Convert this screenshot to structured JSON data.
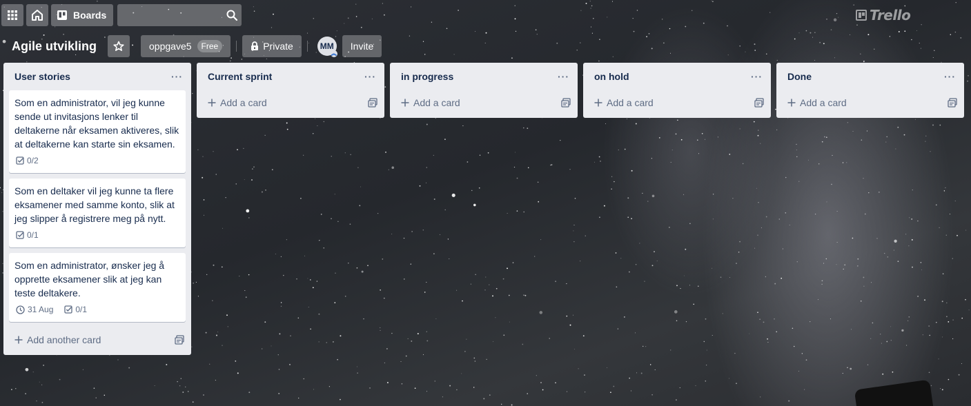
{
  "header": {
    "boards_label": "Boards",
    "search_value": "",
    "logo_text": "Trello"
  },
  "board": {
    "title": "Agile utvikling",
    "team_name": "oppgave5",
    "team_badge": "Free",
    "visibility": "Private",
    "member_initials": "MM",
    "invite_label": "Invite"
  },
  "lists": [
    {
      "title": "User stories",
      "cards": [
        {
          "text": "Som en administrator, vil jeg kunne sende ut invitasjons lenker til deltakerne når eksamen aktiveres, slik at deltakerne kan starte sin eksamen.",
          "checklist": "0/2",
          "due": ""
        },
        {
          "text": "Som en deltaker vil jeg kunne ta flere eksamener med samme konto, slik at jeg slipper å registrere meg på nytt.",
          "checklist": "0/1",
          "due": ""
        },
        {
          "text": "Som en administrator, ønsker jeg å opprette eksamener slik at jeg kan teste deltakere.",
          "checklist": "0/1",
          "due": "31 Aug"
        }
      ],
      "add_label": "Add another card"
    },
    {
      "title": "Current sprint",
      "cards": [],
      "add_label": "Add a card"
    },
    {
      "title": "in progress",
      "cards": [],
      "add_label": "Add a card"
    },
    {
      "title": "on hold",
      "cards": [],
      "add_label": "Add a card"
    },
    {
      "title": "Done",
      "cards": [],
      "add_label": "Add a card"
    }
  ],
  "colors": {
    "list_bg": "#ebecf0",
    "text": "#172b4d",
    "muted": "#5e6c84"
  }
}
